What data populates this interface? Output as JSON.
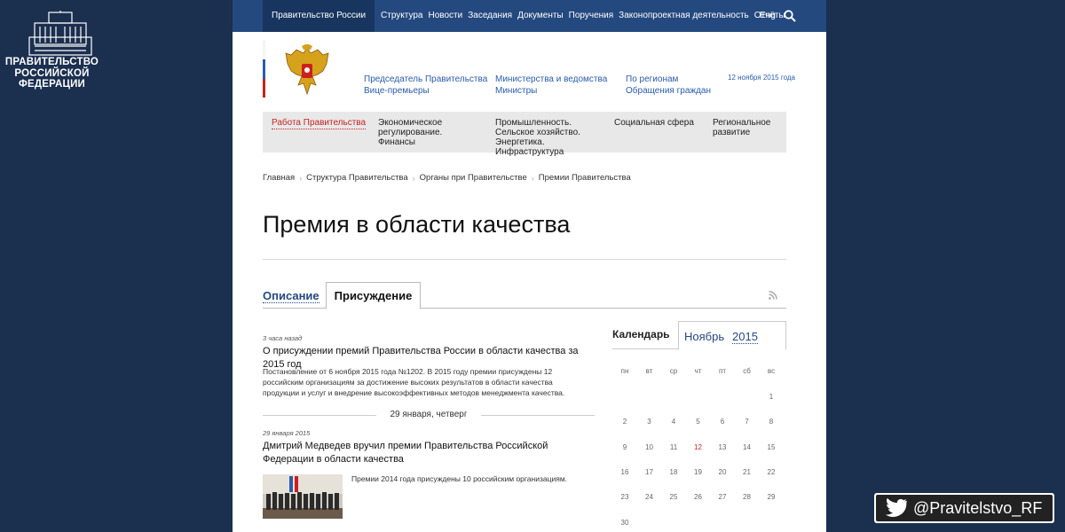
{
  "brand": {
    "title_lines": [
      "ПРАВИТЕЛЬСТВО",
      "РОССИЙСКОЙ",
      "ФЕДЕРАЦИИ"
    ],
    "logo_icon": "government-house-icon"
  },
  "twitter": {
    "handle": "@Pravitelstvo_RF",
    "icon": "twitter-bird-icon"
  },
  "topnav": {
    "items": [
      "Правительство России",
      "Структура",
      "Новости",
      "Заседания",
      "Документы",
      "Поручения",
      "Законопроектная деятельность",
      "Отчёты"
    ],
    "lang": "Eng",
    "search_icon": "search-icon"
  },
  "header": {
    "links": [
      "Председатель Правительства",
      "Вице-премьеры",
      "Министерства и ведомства",
      "Министры",
      "По регионам",
      "Обращения граждан"
    ],
    "date": "12 ноября 2015 года",
    "social_icons": [
      "camera-icon",
      "twitter-icon",
      "youtube-icon",
      "people-icon",
      "mobile-icon",
      "eye-icon",
      "rss-icon"
    ]
  },
  "categories": [
    "Работа Правительства",
    "Экономическое регулирование. Финансы",
    "Промышленность. Сельское хозяйство. Энергетика. Инфраструктура",
    "Социальная сфера",
    "Региональное развитие"
  ],
  "breadcrumbs": [
    "Главная",
    "Структура Правительства",
    "Органы при Правительстве",
    "Премии Правительства"
  ],
  "page_title": "Премия в области качества",
  "tabs": [
    "Описание",
    "Присуждение"
  ],
  "news": [
    {
      "time": "3 часа назад",
      "title": "О присуждении премий Правительства России в области качества за 2015 год",
      "text": "Постановление от 6 ноября 2015 года №1202. В 2015 году премии присуждены 12 российским организациям за достижение высоких результатов в области качества продукции и услуг и внедрение высокоэффективных методов менеджмента качества."
    },
    {
      "time": "29 января 2015",
      "title": "Дмитрий Медведев вручил премии Правительства Российской Федерации в области качества",
      "text": "Премии 2014 года присуждены 10 российским организациям."
    }
  ],
  "date_divider": "29 января, четверг",
  "calendar": {
    "label": "Календарь",
    "month": "Ноябрь",
    "year": "2015",
    "weekdays": [
      "пн",
      "вт",
      "ср",
      "чт",
      "пт",
      "сб",
      "вс"
    ],
    "first_weekday_index": 6,
    "days_in_month": 30,
    "today": 12
  },
  "colors": {
    "brand_bg": "#1b2f4f",
    "topbar": "#24497f",
    "link": "#2a5caa",
    "accent_red": "#cc1f1f"
  }
}
